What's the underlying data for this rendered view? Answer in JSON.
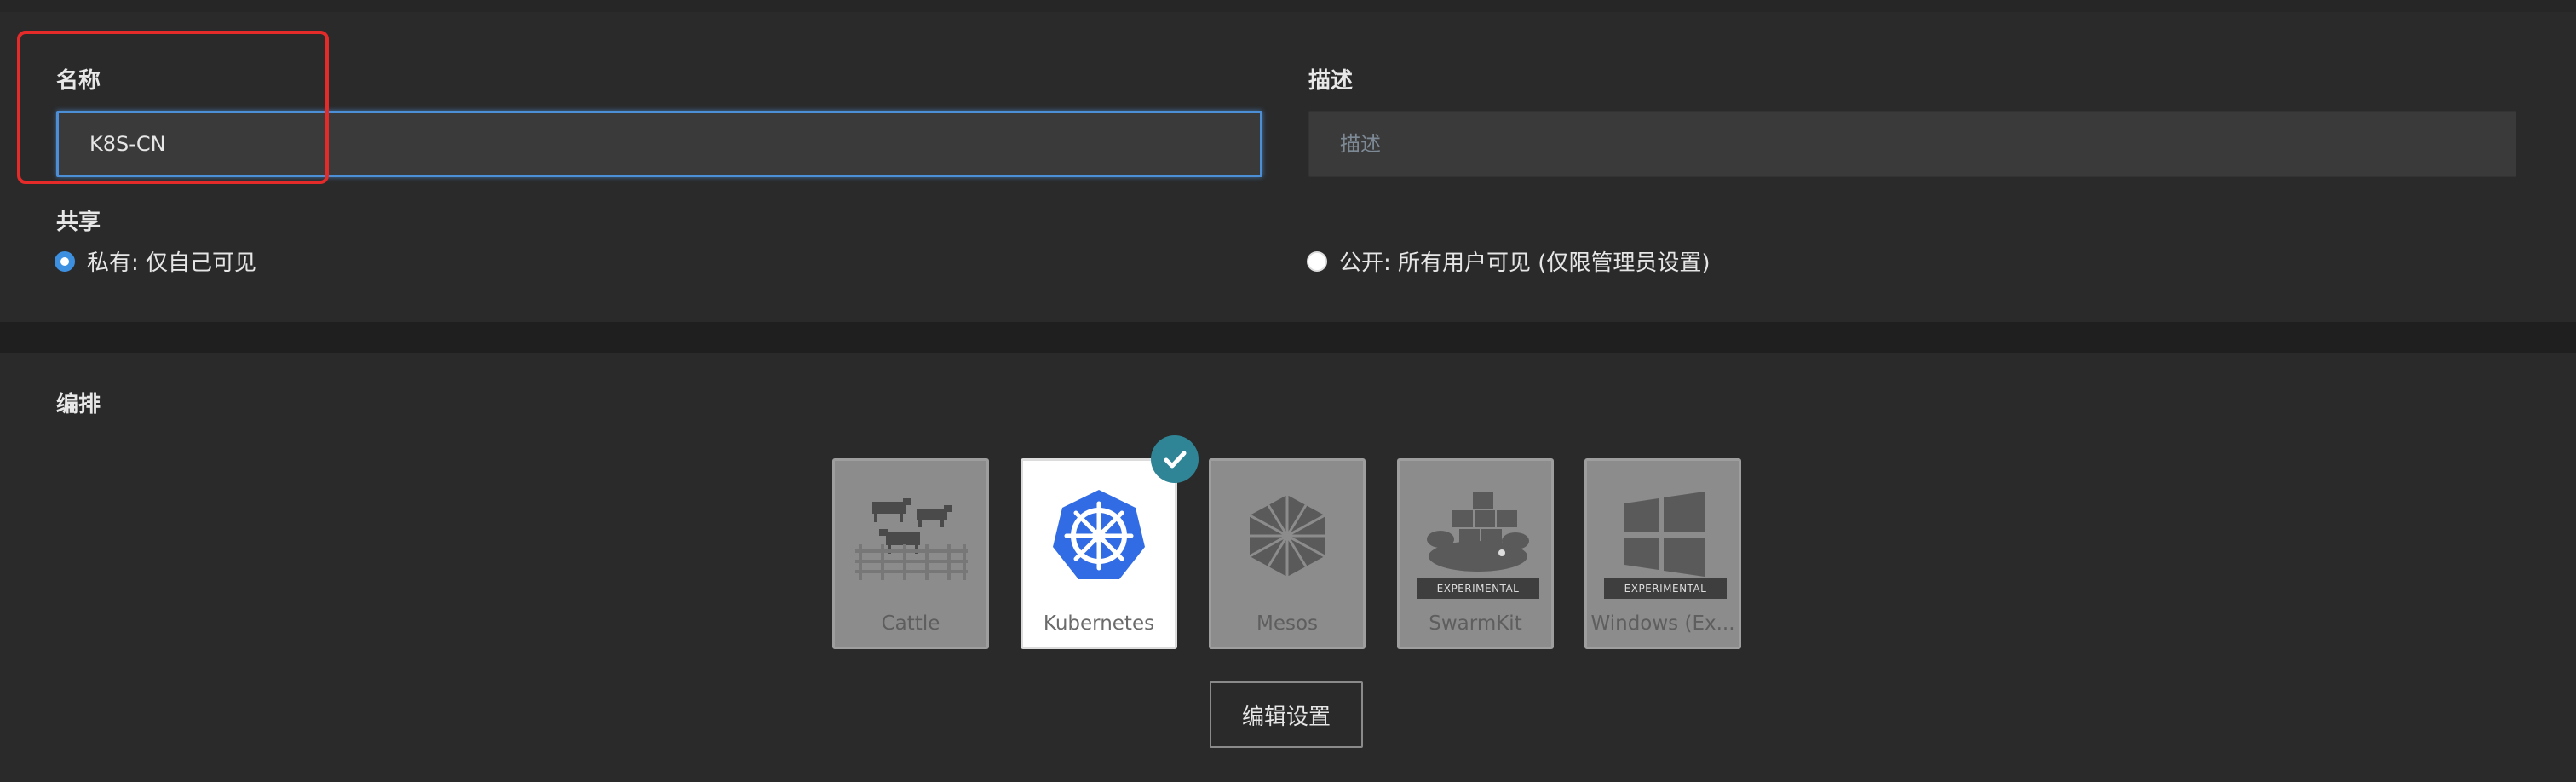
{
  "form": {
    "name": {
      "label": "名称",
      "value": "K8S-CN"
    },
    "description": {
      "label": "描述",
      "value": "",
      "placeholder": "描述"
    },
    "sharing": {
      "label": "共享",
      "options": [
        {
          "label": "私有: 仅自己可见",
          "checked": true
        },
        {
          "label": "公开: 所有用户可见 (仅限管理员设置)",
          "checked": false
        }
      ]
    }
  },
  "orchestration": {
    "label": "编排",
    "tiles": [
      {
        "label": "Cattle",
        "icon": "cattle-icon",
        "selected": false,
        "badge": ""
      },
      {
        "label": "Kubernetes",
        "icon": "kubernetes-icon",
        "selected": true,
        "badge": ""
      },
      {
        "label": "Mesos",
        "icon": "mesos-icon",
        "selected": false,
        "badge": ""
      },
      {
        "label": "SwarmKit",
        "icon": "swarmkit-icon",
        "selected": false,
        "badge": "EXPERIMENTAL"
      },
      {
        "label": "Windows (Ex...",
        "icon": "windows-icon",
        "selected": false,
        "badge": "EXPERIMENTAL"
      }
    ],
    "edit_button": "编辑设置"
  },
  "colors": {
    "accent": "#4d8fd6",
    "highlight": "#e52a2a",
    "check_badge": "#2f8496",
    "kubernetes_blue": "#326ce5"
  }
}
